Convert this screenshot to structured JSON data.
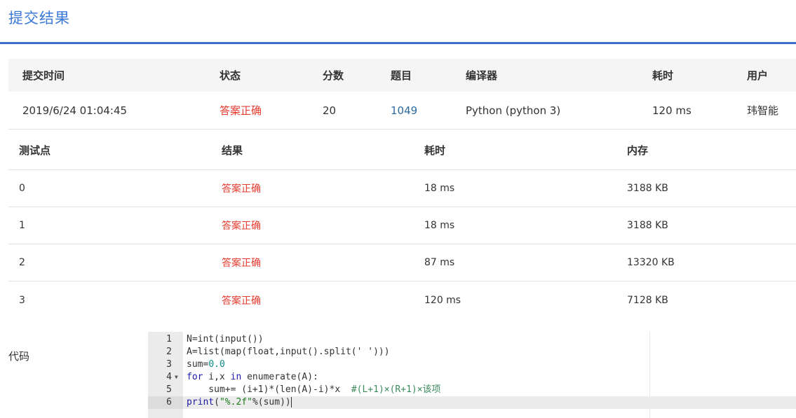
{
  "page": {
    "title": "提交结果"
  },
  "summary": {
    "headers": {
      "time": "提交时间",
      "status": "状态",
      "score": "分数",
      "problem": "题目",
      "compiler": "编译器",
      "elapsed": "耗时",
      "user": "用户"
    },
    "row": {
      "time": "2019/6/24 01:04:45",
      "status": "答案正确",
      "score": "20",
      "problem": "1049",
      "compiler": "Python (python 3)",
      "elapsed": "120 ms",
      "user": "玮智能"
    }
  },
  "tests": {
    "headers": {
      "point": "测试点",
      "result": "结果",
      "time": "耗时",
      "memory": "内存"
    },
    "rows": [
      {
        "point": "0",
        "result": "答案正确",
        "time": "18 ms",
        "memory": "3188 KB"
      },
      {
        "point": "1",
        "result": "答案正确",
        "time": "18 ms",
        "memory": "3188 KB"
      },
      {
        "point": "2",
        "result": "答案正确",
        "time": "87 ms",
        "memory": "13320 KB"
      },
      {
        "point": "3",
        "result": "答案正确",
        "time": "120 ms",
        "memory": "7128 KB"
      }
    ]
  },
  "code": {
    "label": "代码",
    "line_numbers": [
      "1",
      "2",
      "3",
      "4",
      "5",
      "6"
    ],
    "lines": {
      "l1": {
        "a": "N=int(input())"
      },
      "l2": {
        "a": "A=list(map(float,input().split(' ')))"
      },
      "l3": {
        "a": "sum=",
        "b": "0.0"
      },
      "l4": {
        "kw1": "for",
        "a": " i,x ",
        "kw2": "in",
        "b": " enumerate(A):"
      },
      "l5": {
        "a": "    sum+= (i+1)*(len(A)-i)*x  ",
        "comment": "#(L+1)×(R+1)×该项"
      },
      "l6": {
        "kw": "print",
        "a": "(",
        "str": "\"%.2f\"",
        "b": "%(sum))"
      }
    },
    "active_line": 6
  },
  "colors": {
    "accent": "#3b6ecb",
    "status_ok": "#e63b2e",
    "link": "#2c6aa0"
  }
}
